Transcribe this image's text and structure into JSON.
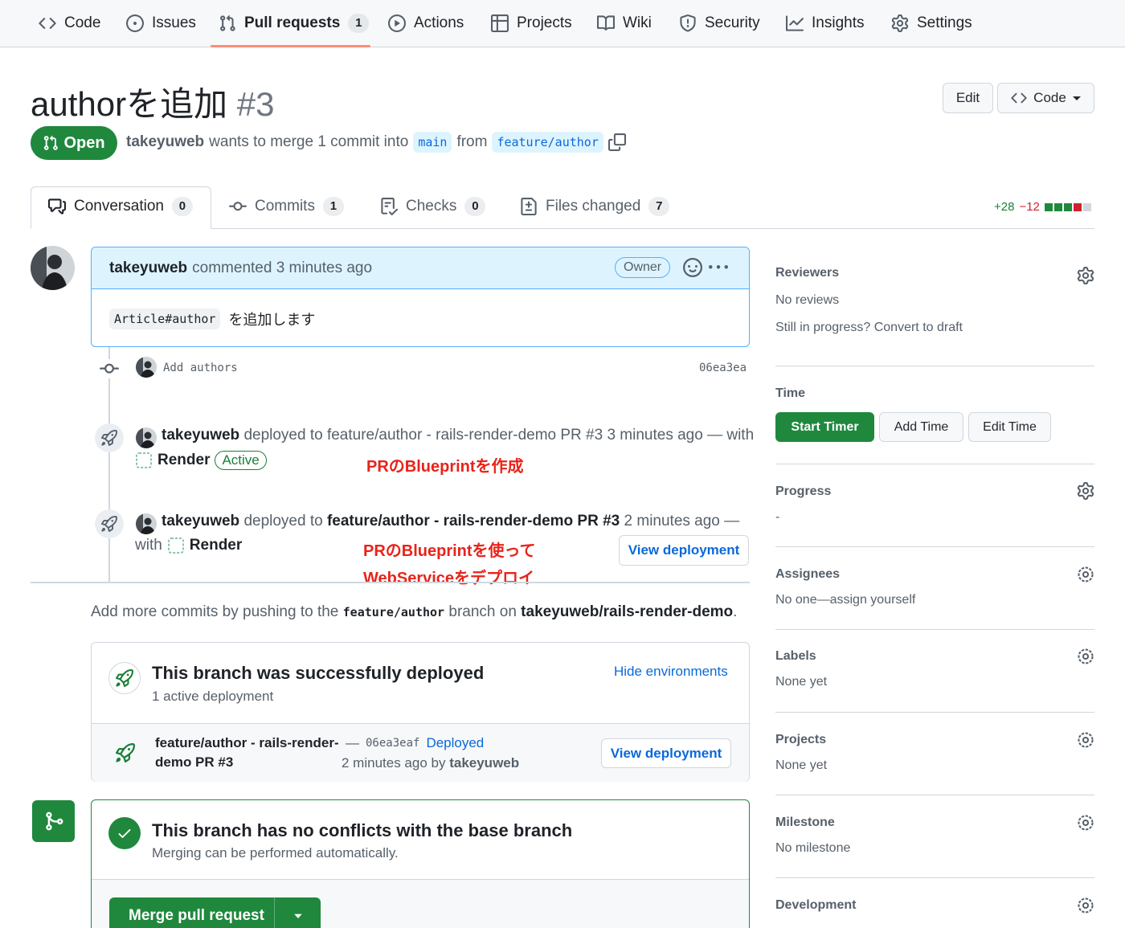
{
  "repo_nav": {
    "items": [
      {
        "label": "Code"
      },
      {
        "label": "Issues"
      },
      {
        "label": "Pull requests",
        "count": "1"
      },
      {
        "label": "Actions"
      },
      {
        "label": "Projects"
      },
      {
        "label": "Wiki"
      },
      {
        "label": "Security"
      },
      {
        "label": "Insights"
      },
      {
        "label": "Settings"
      }
    ],
    "selected": "Pull requests"
  },
  "header": {
    "title": "authorを追加",
    "number": "#3",
    "edit_label": "Edit",
    "code_label": "Code",
    "state": "Open",
    "author": "takeyuweb",
    "merge_text": "wants to merge 1 commit into",
    "base_branch": "main",
    "from_text": "from",
    "head_branch": "feature/author"
  },
  "tabs": [
    {
      "label": "Conversation",
      "count": "0"
    },
    {
      "label": "Commits",
      "count": "1"
    },
    {
      "label": "Checks",
      "count": "0"
    },
    {
      "label": "Files changed",
      "count": "7"
    }
  ],
  "diffstat": {
    "additions": "+28",
    "deletions": "−12"
  },
  "comment": {
    "author": "takeyuweb",
    "time": "commented 3 minutes ago",
    "role": "Owner",
    "body_code": "Article#author",
    "body_text": "を追加します"
  },
  "timeline": {
    "commit": {
      "message": "Add authors",
      "sha": "06ea3ea"
    },
    "deploy1": {
      "actor": "takeyuweb",
      "text": "deployed to feature/author - rails-render-demo PR #3 3 minutes ago — with",
      "service": "Render",
      "status": "Active"
    },
    "deploy2": {
      "actor": "takeyuweb",
      "prefix": "deployed to",
      "env": "feature/author - rails-render-demo PR #3",
      "time": "2 minutes ago —",
      "with": "with",
      "service": "Render",
      "button": "View deployment"
    },
    "annotations": {
      "a1": "PRのBlueprintを作成",
      "a2_line1": "PRのBlueprintを使って",
      "a2_line2": "WebServiceをデプロイ"
    }
  },
  "push_hint": {
    "prefix": "Add more commits by pushing to the",
    "branch": "feature/author",
    "middle": "branch on",
    "repo": "takeyuweb/rails-render-demo",
    "suffix": "."
  },
  "deploy_box": {
    "title": "This branch was successfully deployed",
    "subtitle": "1 active deployment",
    "hide_link": "Hide environments",
    "env_line1": "feature/author - rails-render-",
    "env_line2": "demo PR #3",
    "dash": "—",
    "sha": "06ea3eaf",
    "status": "Deployed",
    "time": "2 minutes ago by",
    "by": "takeyuweb",
    "button": "View deployment"
  },
  "merge_box": {
    "title": "This branch has no conflicts with the base branch",
    "subtitle": "Merging can be performed automatically.",
    "button": "Merge pull request"
  },
  "sidebar": {
    "reviewers": {
      "title": "Reviewers",
      "value": "No reviews",
      "hint": "Still in progress? Convert to draft"
    },
    "time": {
      "title": "Time",
      "start": "Start Timer",
      "add": "Add Time",
      "edit": "Edit Time"
    },
    "progress": {
      "title": "Progress",
      "value": "-"
    },
    "assignees": {
      "title": "Assignees",
      "value": "No one—assign yourself"
    },
    "labels": {
      "title": "Labels",
      "value": "None yet"
    },
    "projects": {
      "title": "Projects",
      "value": "None yet"
    },
    "milestone": {
      "title": "Milestone",
      "value": "No milestone"
    },
    "development": {
      "title": "Development"
    }
  },
  "colors": {
    "accent_green": "#1f883d",
    "link_blue": "#0969da",
    "annotation_red": "#e8231a",
    "tab_underline": "#fd8c73"
  }
}
